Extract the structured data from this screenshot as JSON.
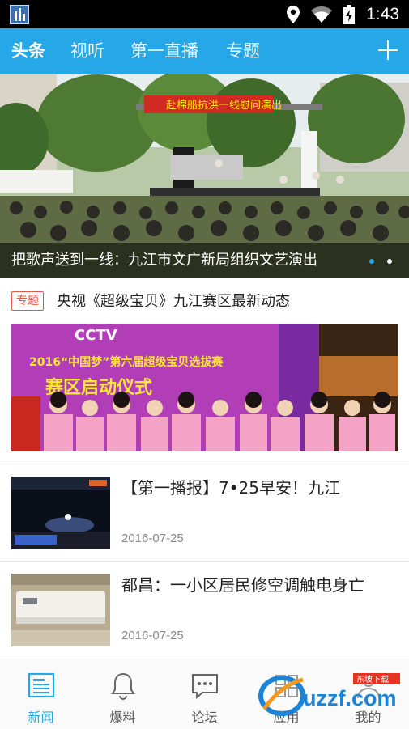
{
  "status_bar": {
    "time": "1:43",
    "icons": [
      "location-icon",
      "wifi-icon",
      "battery-icon"
    ]
  },
  "top_nav": {
    "tabs": [
      {
        "label": "头条",
        "active": true
      },
      {
        "label": "视听",
        "active": false
      },
      {
        "label": "第一直播",
        "active": false
      },
      {
        "label": "专题",
        "active": false
      }
    ],
    "add_icon": "plus-icon"
  },
  "hero": {
    "banner_text": "赴棉船抗洪一线慰问演出",
    "caption": "把歌声送到一线：九江市文广新局组织文艺演出",
    "slides_count": 2,
    "active_slide": 1
  },
  "topic": {
    "tag": "专题",
    "title": "央视《超级宝贝》九江赛区最新动态",
    "image_logo": "CCTV",
    "image_line1": "2016“中国梦”第六届超级宝贝选拔赛",
    "image_line2": "赛区启动仪式"
  },
  "news": [
    {
      "title": "【第一播报】7•25早安！九江",
      "date": "2016-07-25"
    },
    {
      "title": "都昌：一小区居民修空调触电身亡",
      "date": "2016-07-25"
    }
  ],
  "bottom_nav": {
    "items": [
      {
        "label": "新闻",
        "icon": "news-icon",
        "active": true
      },
      {
        "label": "爆料",
        "icon": "bell-icon",
        "active": false
      },
      {
        "label": "论坛",
        "icon": "chat-icon",
        "active": false
      },
      {
        "label": "应用",
        "icon": "apps-icon",
        "active": false
      },
      {
        "label": "我的",
        "icon": "user-icon",
        "active": false
      }
    ]
  },
  "watermark": {
    "text": "uzzf.com",
    "sub": "东坡下载"
  },
  "colors": {
    "accent": "#26a8e8",
    "tag": "#e45a48"
  }
}
